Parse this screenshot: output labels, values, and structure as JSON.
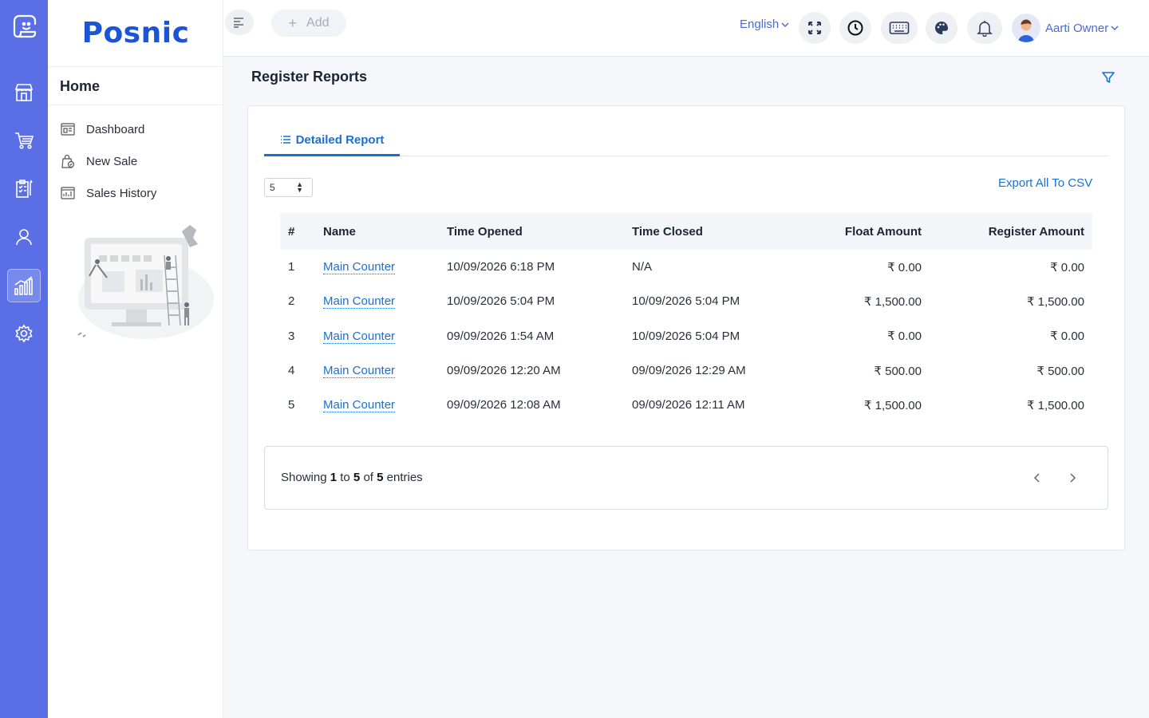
{
  "brand": {
    "name": "Posnic"
  },
  "rail": {
    "items": [
      "store-icon",
      "cart-icon",
      "clipboard-icon",
      "user-icon",
      "chart-icon",
      "settings-icon"
    ],
    "active": "chart-icon"
  },
  "sidebar": {
    "section_title": "Home",
    "items": [
      {
        "label": "Dashboard",
        "icon": "dashboard-icon"
      },
      {
        "label": "New Sale",
        "icon": "new-sale-icon"
      },
      {
        "label": "Sales History",
        "icon": "sales-history-icon"
      }
    ]
  },
  "topbar": {
    "add_label": "Add",
    "language": "English",
    "user_name": "Aarti Owner",
    "icons": [
      "fullscreen-icon",
      "clock-icon",
      "keyboard-icon",
      "palette-icon",
      "bell-icon"
    ]
  },
  "page": {
    "title": "Register Reports"
  },
  "tabs": {
    "detailed_label": "Detailed Report"
  },
  "controls": {
    "page_size": "5",
    "export_label": "Export All To CSV"
  },
  "table": {
    "headers": {
      "hash": "#",
      "name": "Name",
      "opened": "Time Opened",
      "closed": "Time Closed",
      "float": "Float Amount",
      "register": "Register Amount"
    },
    "rows": [
      {
        "idx": "1",
        "name": "Main Counter",
        "opened": "10/09/2026 6:18 PM",
        "closed": "N/A",
        "float": "₹ 0.00",
        "register": "₹ 0.00"
      },
      {
        "idx": "2",
        "name": "Main Counter",
        "opened": "10/09/2026 5:04 PM",
        "closed": "10/09/2026 5:04 PM",
        "float": "₹ 1,500.00",
        "register": "₹ 1,500.00"
      },
      {
        "idx": "3",
        "name": "Main Counter",
        "opened": "09/09/2026 1:54 AM",
        "closed": "10/09/2026 5:04 PM",
        "float": "₹ 0.00",
        "register": "₹ 0.00"
      },
      {
        "idx": "4",
        "name": "Main Counter",
        "opened": "09/09/2026 12:20 AM",
        "closed": "09/09/2026 12:29 AM",
        "float": "₹ 500.00",
        "register": "₹ 500.00"
      },
      {
        "idx": "5",
        "name": "Main Counter",
        "opened": "09/09/2026 12:08 AM",
        "closed": "09/09/2026 12:11 AM",
        "float": "₹ 1,500.00",
        "register": "₹ 1,500.00"
      }
    ]
  },
  "footer": {
    "showing_prefix": "Showing",
    "from": "1",
    "to_word": "to",
    "to": "5",
    "of_word": "of",
    "total": "5",
    "suffix": "entries"
  },
  "colors": {
    "rail": "#5a6fe6",
    "brand": "#1a55d6",
    "link": "#1a6fd6"
  }
}
